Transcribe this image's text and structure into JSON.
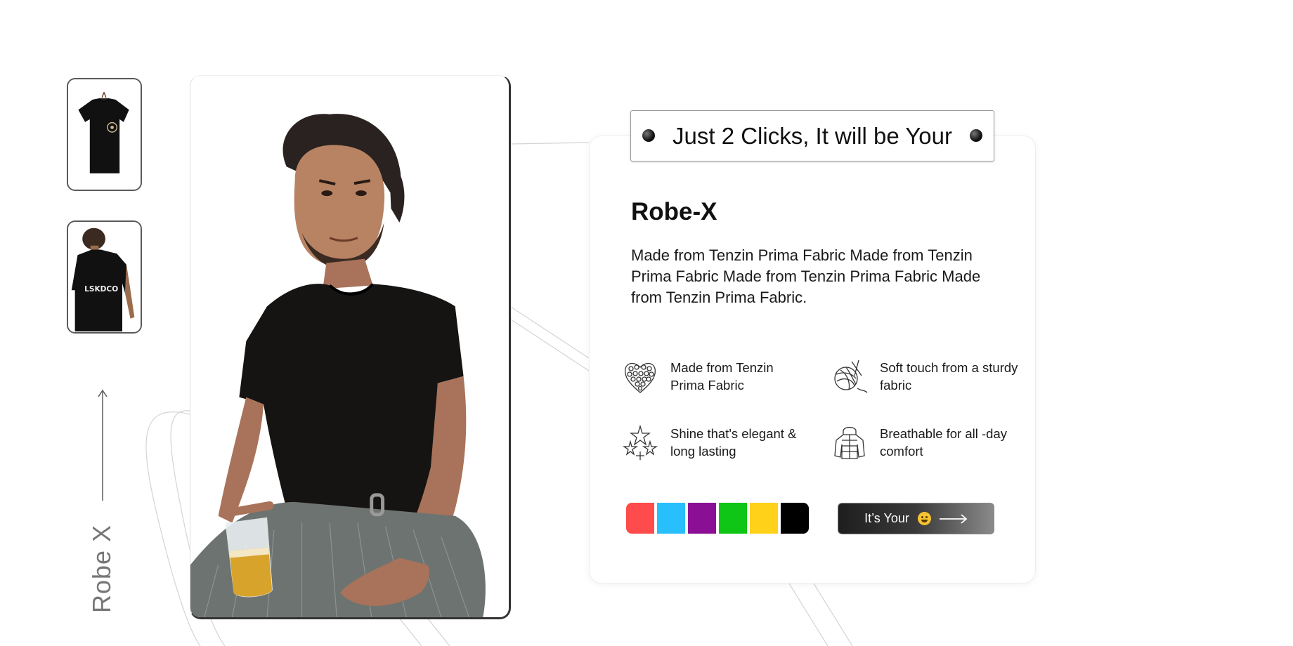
{
  "thumbnails": [
    {
      "name": "front-tshirt"
    },
    {
      "name": "back-tshirt",
      "print": "LSKDCO"
    }
  ],
  "side_title": "Robe X",
  "banner": {
    "text": "Just 2 Clicks, It will be Your"
  },
  "product": {
    "title": "Robe-X",
    "description": "Made from Tenzin Prima Fabric Made from Tenzin Prima Fabric Made from Tenzin Prima Fabric Made from Tenzin Prima Fabric."
  },
  "features": [
    {
      "icon": "hearts-icon",
      "text": "Made from Tenzin Prima Fabric"
    },
    {
      "icon": "yarn-ball-icon",
      "text": "Soft touch from a sturdy fabric"
    },
    {
      "icon": "stars-icon",
      "text": "Shine that's elegant & long lasting"
    },
    {
      "icon": "jacket-icon",
      "text": "Breathable for all -day comfort"
    }
  ],
  "colors": [
    "#ff4b4b",
    "#27bffc",
    "#8b0f95",
    "#0fc515",
    "#ffd119",
    "#000000"
  ],
  "cta": {
    "label": "It’s Your",
    "emoji": "grinning-face",
    "arrow": "long-arrow-right-icon"
  }
}
